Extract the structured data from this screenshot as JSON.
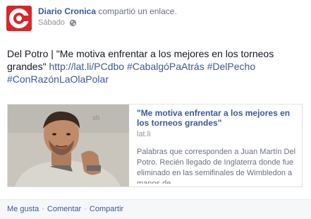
{
  "post": {
    "author": "Diario Cronica",
    "action": "compartió un enlace.",
    "timestamp": "Sábado",
    "privacy_icon": "globe-icon",
    "logo_letter": "C"
  },
  "message": {
    "text": "Del Potro | \"Me motiva enfrentar a los mejores en los torneos grandes\" ",
    "url": "http://lat.li/PCdbo",
    "hashtags": [
      "#CabalgóPaAtrás",
      "#DelPecho",
      "#ConRazónLaOlaPolar"
    ]
  },
  "link_card": {
    "title": "\"Me motiva enfrentar a los mejores en los torneos grandes\"",
    "domain": "lat.li",
    "description": "Palabras que corresponden a Juan Martín Del Potro. Recién llegado de Inglaterra donde fue eliminado en las semifinales de Wimbledon a manos de..."
  },
  "actions": {
    "like": "Me gusta",
    "comment": "Comentar",
    "share": "Compartir",
    "separator": "·"
  },
  "colors": {
    "brand_red": "#d9262b",
    "link_blue": "#3b5998"
  }
}
